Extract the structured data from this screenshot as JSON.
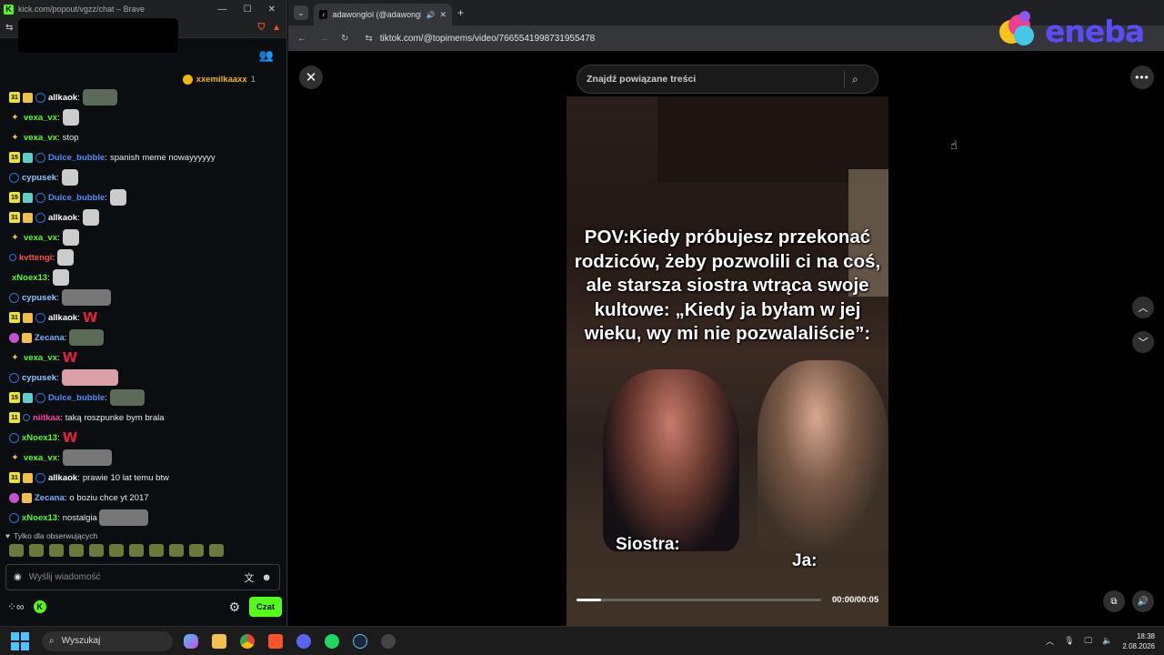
{
  "kick_window": {
    "title": "kick.com/popout/vgzz/chat – Brave",
    "pinned": {
      "user": "xxemilkaaxx",
      "count": "1"
    },
    "messages": [
      {
        "badges": [
          "31",
          "gift",
          "ring"
        ],
        "user": "allkaok",
        "color": "#ffffff",
        "text": "",
        "emote": "emote"
      },
      {
        "badges": [
          "vip"
        ],
        "user": "vexa_vx",
        "color": "#53fc18",
        "text": "",
        "emote": "emote-small"
      },
      {
        "badges": [
          "vip"
        ],
        "user": "vexa_vx",
        "color": "#53fc18",
        "text": "stop",
        "emote": ""
      },
      {
        "badges": [
          "15",
          "gift2",
          "ring"
        ],
        "user": "Dulce_bubble",
        "color": "#4e8ef7",
        "text": "spanish meme nowayyyyyy",
        "emote": ""
      },
      {
        "badges": [
          "ring"
        ],
        "user": "cypusek",
        "color": "#8ec5ff",
        "text": "",
        "emote": "emote-small"
      },
      {
        "badges": [
          "15",
          "gift2",
          "ring"
        ],
        "user": "Dulce_bubble",
        "color": "#4e8ef7",
        "text": "",
        "emote": "emote-small"
      },
      {
        "badges": [
          "31",
          "gift",
          "ring"
        ],
        "user": "allkaok",
        "color": "#ffffff",
        "text": "",
        "emote": "emote-small"
      },
      {
        "badges": [
          "vip"
        ],
        "user": "vexa_vx",
        "color": "#53fc18",
        "text": "",
        "emote": "emote-small"
      },
      {
        "badges": [
          "dot"
        ],
        "user": "kvttengi",
        "color": "#ff4e4e",
        "text": "",
        "emote": "emote-small"
      },
      {
        "badges": [],
        "user": "xNoex13",
        "color": "#53fc18",
        "text": "",
        "emote": "emote-small"
      },
      {
        "badges": [
          "ring"
        ],
        "user": "cypusek",
        "color": "#8ec5ff",
        "text": "",
        "emote": "emote-gray"
      },
      {
        "badges": [
          "31",
          "gift",
          "ring"
        ],
        "user": "allkaok",
        "color": "#ffffff",
        "text": "",
        "emote": "W"
      },
      {
        "badges": [
          "og",
          "gift"
        ],
        "user": "Zecana",
        "color": "#6fb3ff",
        "text": "",
        "emote": "emote"
      },
      {
        "badges": [
          "vip"
        ],
        "user": "vexa_vx",
        "color": "#53fc18",
        "text": "",
        "emote": "W"
      },
      {
        "badges": [
          "ring"
        ],
        "user": "cypusek",
        "color": "#8ec5ff",
        "text": "",
        "emote": "emote-pink"
      },
      {
        "badges": [
          "15",
          "gift2",
          "ring"
        ],
        "user": "Dulce_bubble",
        "color": "#4e8ef7",
        "text": "",
        "emote": "emote"
      },
      {
        "badges": [
          "11",
          "dot"
        ],
        "user": "niitkaa",
        "color": "#ff3fa4",
        "text": "taką roszpunke bym brala",
        "emote": ""
      },
      {
        "badges": [
          "ring"
        ],
        "user": "xNoex13",
        "color": "#53fc18",
        "text": "",
        "emote": "W"
      },
      {
        "badges": [
          "vip"
        ],
        "user": "vexa_vx",
        "color": "#53fc18",
        "text": "",
        "emote": "emote-gray"
      },
      {
        "badges": [
          "31",
          "gift",
          "ring"
        ],
        "user": "allkaok",
        "color": "#ffffff",
        "text": "prawie 10 lat temu btw",
        "emote": ""
      },
      {
        "badges": [
          "og",
          "gift"
        ],
        "user": "Zecana",
        "color": "#6fb3ff",
        "text": "o boziu chce yt 2017",
        "emote": ""
      },
      {
        "badges": [
          "ring"
        ],
        "user": "xNoex13",
        "color": "#53fc18",
        "text": "nostalgia",
        "emote": "emote-gray"
      }
    ],
    "followers_only": "Tylko dla obserwujących",
    "input_placeholder": "Wyślij wiadomość",
    "chat_button": "Czat"
  },
  "browser": {
    "tab_title": "adawonglol (@adawonglol)",
    "url": "tiktok.com/@topimems/video/7665541998731955478",
    "brand": "eneba",
    "search_placeholder": "Znajdź powiązane treści",
    "video": {
      "pov_text": "POV:Kiedy próbujesz przekonać rodziców, żeby pozwolili ci na coś, ale starsza siostra wtrąca swoje kultowe: „Kiedy ja byłam w jej wieku, wy mi nie pozwalaliście”:",
      "label_left": "Siostra:",
      "label_right": "Ja:",
      "time": "00:00/00:05",
      "progress": 0.1
    }
  },
  "taskbar": {
    "search": "Wyszukaj",
    "time": "18:38",
    "date": "2.08.2026"
  }
}
